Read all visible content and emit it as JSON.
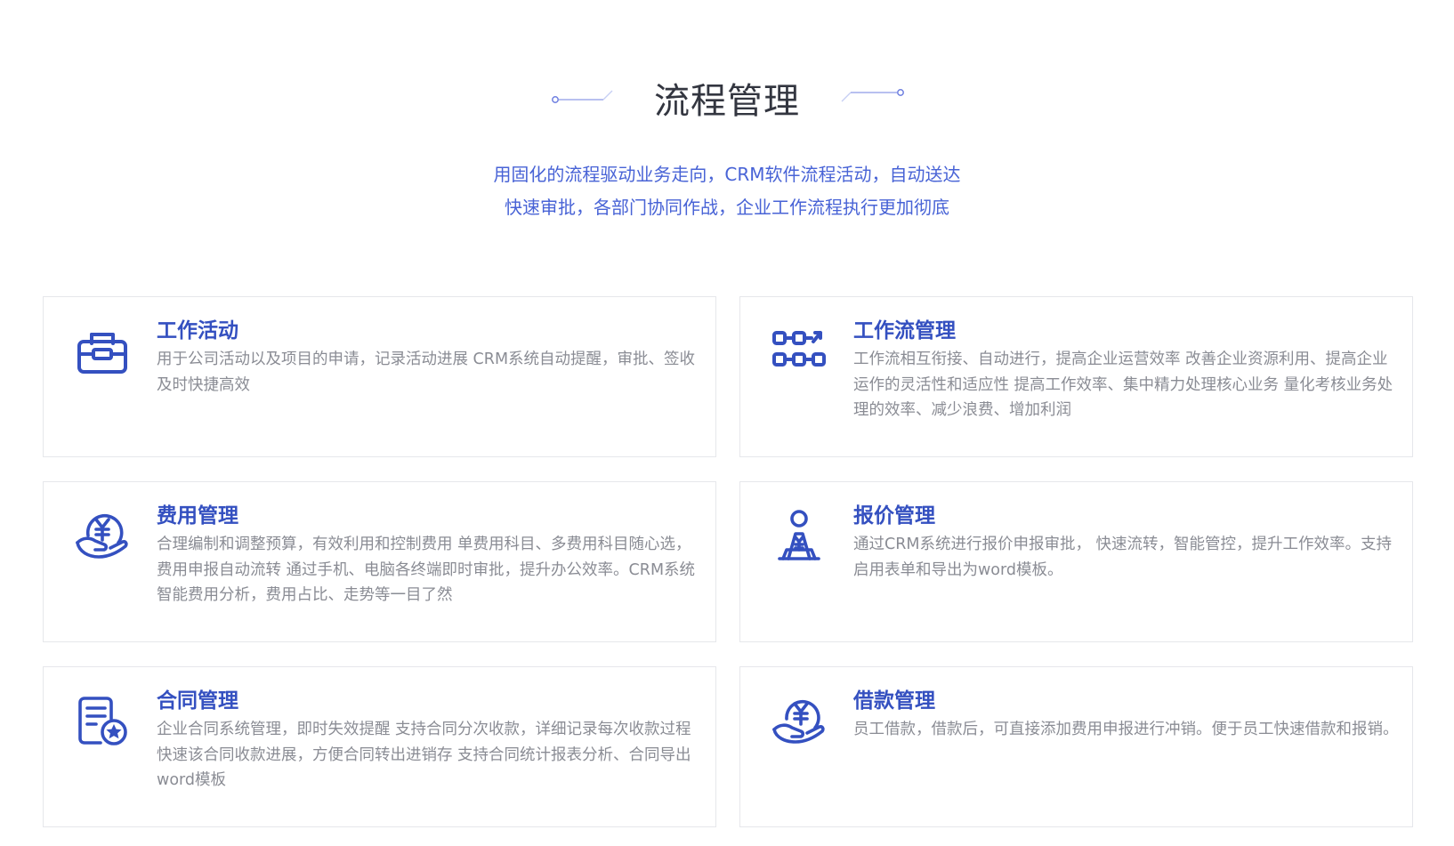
{
  "section": {
    "title": "流程管理",
    "subtitle_line1": "用固化的流程驱动业务走向，CRM软件流程活动，自动送达",
    "subtitle_line2": "快速审批，各部门协同作战，企业工作流程执行更加彻底"
  },
  "colors": {
    "accent": "#3450c0",
    "icon": "#3450c0",
    "subtitle": "#4863d6",
    "body_text": "#8a8c94",
    "border": "#e6e7eb"
  },
  "cards": [
    {
      "icon": "toolbox-icon",
      "title": "工作活动",
      "desc": "用于公司活动以及项目的申请，记录活动进展 CRM系统自动提醒，审批、签收及时快捷高效"
    },
    {
      "icon": "workflow-icon",
      "title": "工作流管理",
      "desc": "工作流相互衔接、自动进行，提高企业运营效率 改善企业资源利用、提高企业运作的灵活性和适应性 提高工作效率、集中精力处理核心业务 量化考核业务处理的效率、减少浪费、增加利润"
    },
    {
      "icon": "hand-yen-icon",
      "title": "费用管理",
      "desc": "合理编制和调整预算，有效利用和控制费用 单费用科目、多费用科目随心选，费用申报自动流转 通过手机、电脑各终端即时审批，提升办公效率。CRM系统智能费用分析，费用占比、走势等一目了然"
    },
    {
      "icon": "person-yen-icon",
      "title": "报价管理",
      "desc": "通过CRM系统进行报价申报审批， 快速流转，智能管控，提升工作效率。支持启用表单和导出为word模板。"
    },
    {
      "icon": "contract-star-icon",
      "title": "合同管理",
      "desc": "企业合同系统管理，即时失效提醒 支持合同分次收款，详细记录每次收款过程 快速该合同收款进展，方便合同转出进销存 支持合同统计报表分析、合同导出word模板"
    },
    {
      "icon": "loan-yen-icon",
      "title": "借款管理",
      "desc": "员工借款，借款后，可直接添加费用申报进行冲销。便于员工快速借款和报销。"
    }
  ]
}
